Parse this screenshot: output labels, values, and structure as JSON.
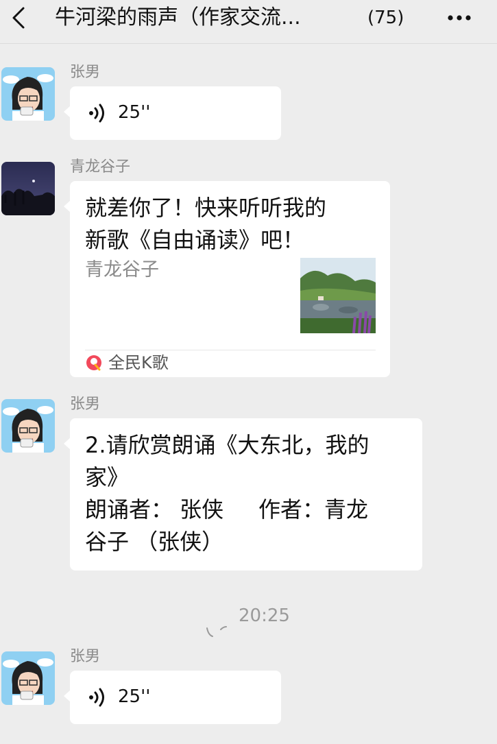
{
  "header": {
    "title": "牛河梁的雨声（作家交流...",
    "member_count": "(75)"
  },
  "messages": [
    {
      "sender": "张男",
      "voice_duration": "25''"
    },
    {
      "sender": "青龙谷子",
      "card_text": "就差你了！快来听听我的\n新歌《自由诵读》吧！",
      "card_author": "青龙谷子",
      "card_source": "全民K歌"
    },
    {
      "sender": "张男",
      "text": "2.请欣赏朗诵《大东北，我的\n家》\n朗诵者： 张侠     作者：青龙\n谷子 （张侠）"
    },
    {
      "sender": "张男",
      "voice_duration": "25''"
    }
  ],
  "timestamp": "20:25",
  "colors": {
    "background": "#ededed",
    "bubble": "#ffffff",
    "sender_name": "#8a8a8a",
    "kge_brand": "#f2495b"
  },
  "icons": {
    "back": "back-icon",
    "more": "more-icon",
    "voice": "voice-icon",
    "kge": "kge-logo-icon"
  }
}
